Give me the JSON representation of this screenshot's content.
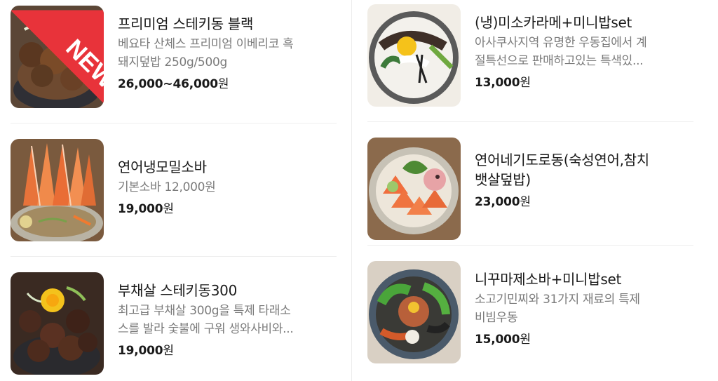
{
  "left_items": [
    {
      "name": "프리미엄 스테키동 블랙",
      "desc_lines": [
        "베요타 산체스 프리미엄 이베리코 흑",
        "돼지덮밥 250g/500g"
      ],
      "price": "26,000~46,000",
      "unit": "원",
      "badge": "NEW",
      "image": "steak-rice-bowl-black-photo"
    },
    {
      "name": "연어냉모밀소바",
      "desc_lines": [
        "기본소바 12,000원"
      ],
      "price": "19,000",
      "unit": "원",
      "image": "salmon-cold-soba-photo"
    },
    {
      "name": "부채살 스테키동300",
      "desc_lines": [
        "최고급 부채살 300g을 특제 타래소",
        "스를 발라 숯불에 구워 생와사비와..."
      ],
      "price": "19,000",
      "unit": "원",
      "image": "flat-iron-steak-bowl-photo"
    }
  ],
  "right_items": [
    {
      "name": "(냉)미소카라메+미니밥set",
      "desc_lines": [
        "아사쿠사지역 유명한 우동집에서 계",
        "절특선으로 판매하고있는 특색있..."
      ],
      "price": "13,000",
      "unit": "원",
      "image": "cold-miso-udon-photo"
    },
    {
      "name_lines": [
        "연어네기도로동(숙성연어,참치",
        "뱃살덮밥)"
      ],
      "price": "23,000",
      "unit": "원",
      "image": "salmon-negitoro-bowl-photo"
    },
    {
      "name": "니꾸마제소바+미니밥set",
      "desc_lines": [
        "소고기민찌와 31가지 재료의 특제",
        "비빔우동"
      ],
      "price": "15,000",
      "unit": "원",
      "image": "niku-maze-soba-photo"
    }
  ],
  "colors": {
    "name": "#1a1a1a",
    "desc": "#7b7b7b",
    "divider": "#eeeeee",
    "badge": "#e8333a"
  }
}
